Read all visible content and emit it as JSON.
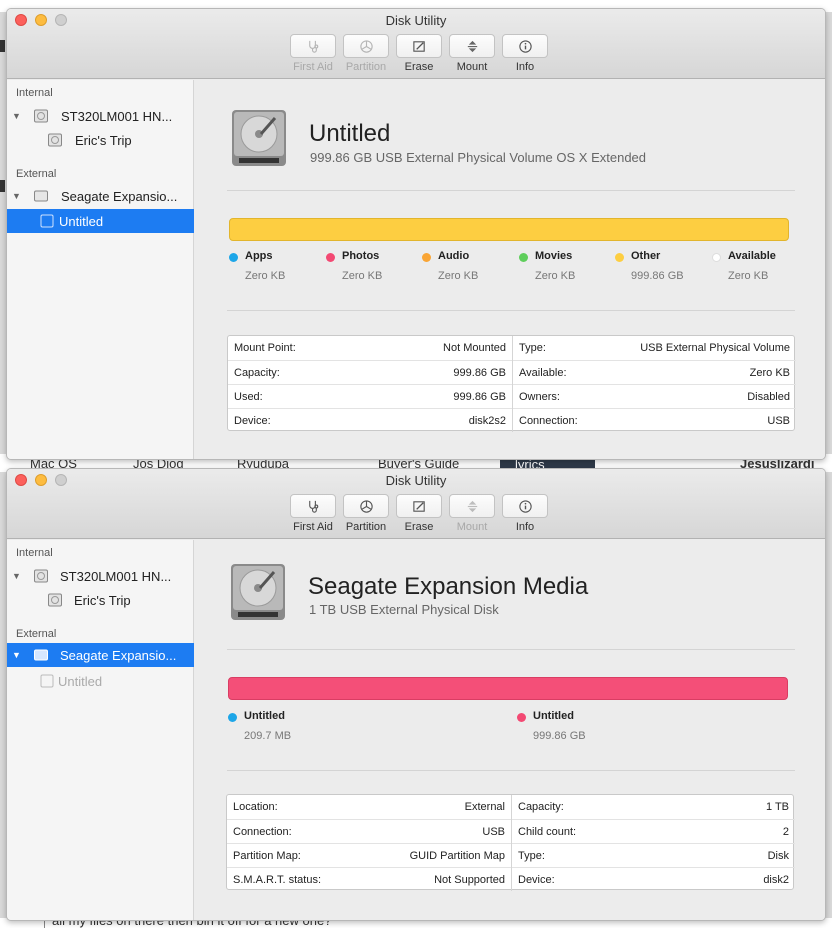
{
  "background": {
    "fragments_between": [
      "Mac OS",
      "Jos Diog",
      "Ryudupa",
      "Buyer's Guide",
      "lyrics",
      "Jesuslizardj"
    ],
    "fragment_bottom": "all my files on there then bin it off for a new one?"
  },
  "colors": {
    "apps": "#1da6e8",
    "photos": "#f34973",
    "audio": "#f9a535",
    "movies": "#5fce5c",
    "other": "#fdce41",
    "available": "#ffffff",
    "selection": "#1d7cf2",
    "volume_bar": "#fdce41",
    "disk_bar": "#f44f78"
  },
  "window1": {
    "title": "Disk Utility",
    "toolbar": [
      {
        "label": "First Aid",
        "icon": "stethoscope-icon",
        "enabled": false
      },
      {
        "label": "Partition",
        "icon": "partition-icon",
        "enabled": false
      },
      {
        "label": "Erase",
        "icon": "erase-icon",
        "enabled": true
      },
      {
        "label": "Mount",
        "icon": "mount-icon",
        "enabled": true
      },
      {
        "label": "Info",
        "icon": "info-icon",
        "enabled": true
      }
    ],
    "sidebar": {
      "internal_label": "Internal",
      "internal_disk": "ST320LM001 HN...",
      "internal_volume": "Eric's Trip",
      "external_label": "External",
      "external_disk": "Seagate Expansio...",
      "external_volume": "Untitled"
    },
    "main": {
      "name": "Untitled",
      "subtitle": "999.86 GB USB External Physical Volume OS X Extended",
      "legend": [
        {
          "name": "Apps",
          "value": "Zero KB"
        },
        {
          "name": "Photos",
          "value": "Zero KB"
        },
        {
          "name": "Audio",
          "value": "Zero KB"
        },
        {
          "name": "Movies",
          "value": "Zero KB"
        },
        {
          "name": "Other",
          "value": "999.86 GB"
        },
        {
          "name": "Available",
          "value": "Zero KB"
        }
      ],
      "info_left": [
        {
          "k": "Mount Point:",
          "v": "Not Mounted"
        },
        {
          "k": "Capacity:",
          "v": "999.86 GB"
        },
        {
          "k": "Used:",
          "v": "999.86 GB"
        },
        {
          "k": "Device:",
          "v": "disk2s2"
        }
      ],
      "info_right": [
        {
          "k": "Type:",
          "v": "USB External Physical Volume"
        },
        {
          "k": "Available:",
          "v": "Zero KB"
        },
        {
          "k": "Owners:",
          "v": "Disabled"
        },
        {
          "k": "Connection:",
          "v": "USB"
        }
      ]
    }
  },
  "window2": {
    "title": "Disk Utility",
    "toolbar": [
      {
        "label": "First Aid",
        "icon": "stethoscope-icon",
        "enabled": true
      },
      {
        "label": "Partition",
        "icon": "partition-icon",
        "enabled": true
      },
      {
        "label": "Erase",
        "icon": "erase-icon",
        "enabled": true
      },
      {
        "label": "Mount",
        "icon": "mount-icon",
        "enabled": false
      },
      {
        "label": "Info",
        "icon": "info-icon",
        "enabled": true
      }
    ],
    "sidebar": {
      "internal_label": "Internal",
      "internal_disk": "ST320LM001 HN...",
      "internal_volume": "Eric's Trip",
      "external_label": "External",
      "external_disk": "Seagate Expansio...",
      "external_volume": "Untitled"
    },
    "main": {
      "name": "Seagate Expansion Media",
      "subtitle": "1 TB USB External Physical Disk",
      "legend": [
        {
          "name": "Untitled",
          "value": "209.7 MB"
        },
        {
          "name": "Untitled",
          "value": "999.86 GB"
        }
      ],
      "info_left": [
        {
          "k": "Location:",
          "v": "External"
        },
        {
          "k": "Connection:",
          "v": "USB"
        },
        {
          "k": "Partition Map:",
          "v": "GUID Partition Map"
        },
        {
          "k": "S.M.A.R.T. status:",
          "v": "Not Supported"
        }
      ],
      "info_right": [
        {
          "k": "Capacity:",
          "v": "1 TB"
        },
        {
          "k": "Child count:",
          "v": "2"
        },
        {
          "k": "Type:",
          "v": "Disk"
        },
        {
          "k": "Device:",
          "v": "disk2"
        }
      ]
    }
  }
}
